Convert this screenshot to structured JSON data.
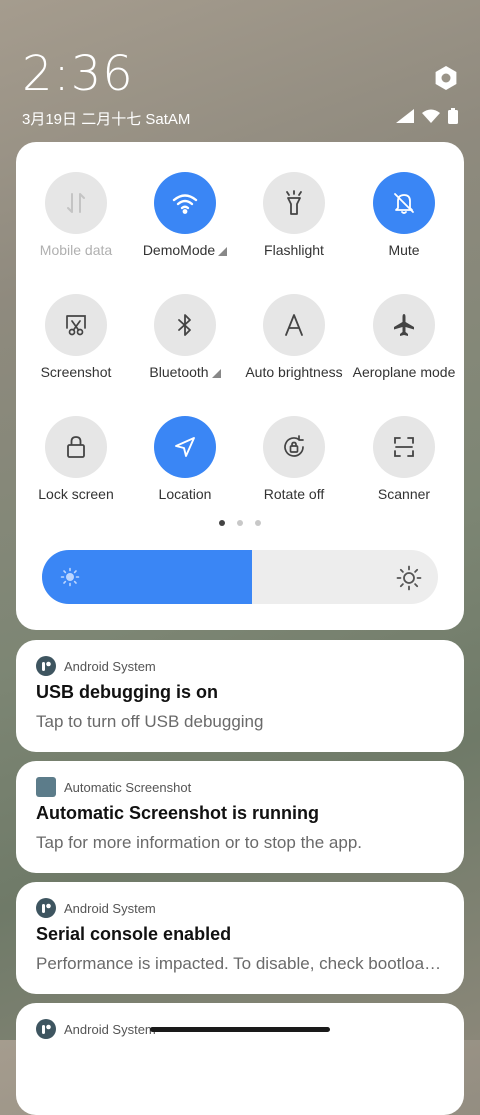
{
  "status": {
    "time": "2:36",
    "date": "3月19日 二月十七 SatAM"
  },
  "quick_settings": {
    "tiles": [
      {
        "label": "Mobile data",
        "icon": "mobile-data-icon",
        "active": false,
        "disabled": true
      },
      {
        "label": "DemoMode",
        "icon": "wifi-icon",
        "active": true,
        "expandable": true
      },
      {
        "label": "Flashlight",
        "icon": "flashlight-icon",
        "active": false
      },
      {
        "label": "Mute",
        "icon": "bell-off-icon",
        "active": true
      },
      {
        "label": "Screenshot",
        "icon": "screenshot-icon",
        "active": false
      },
      {
        "label": "Bluetooth",
        "icon": "bluetooth-icon",
        "active": false,
        "expandable": true
      },
      {
        "label": "Auto brightness",
        "icon": "auto-brightness-icon",
        "active": false
      },
      {
        "label": "Aeroplane mode",
        "icon": "airplane-icon",
        "active": false
      },
      {
        "label": "Lock screen",
        "icon": "lock-icon",
        "active": false
      },
      {
        "label": "Location",
        "icon": "location-icon",
        "active": true
      },
      {
        "label": "Rotate off",
        "icon": "rotate-lock-icon",
        "active": false
      },
      {
        "label": "Scanner",
        "icon": "scanner-icon",
        "active": false
      }
    ],
    "page_count": 3,
    "current_page": 1,
    "brightness_level": 0.53
  },
  "notifications": [
    {
      "app": "Android System",
      "icon": "android-system-icon",
      "title": "USB debugging is on",
      "body": "Tap to turn off USB debugging"
    },
    {
      "app": "Automatic Screenshot",
      "icon": "automatic-screenshot-icon",
      "title": "Automatic Screenshot is running",
      "body": "Tap for more information or to stop the app."
    },
    {
      "app": "Android System",
      "icon": "android-system-icon",
      "title": "Serial console enabled",
      "body": "Performance is impacted. To disable, check bootloader."
    },
    {
      "app": "Android System",
      "icon": "android-system-icon",
      "title": "",
      "body": ""
    }
  ],
  "colors": {
    "accent": "#3a86f5",
    "tile_inactive": "#e6e6e6",
    "panel": "#ffffff"
  }
}
